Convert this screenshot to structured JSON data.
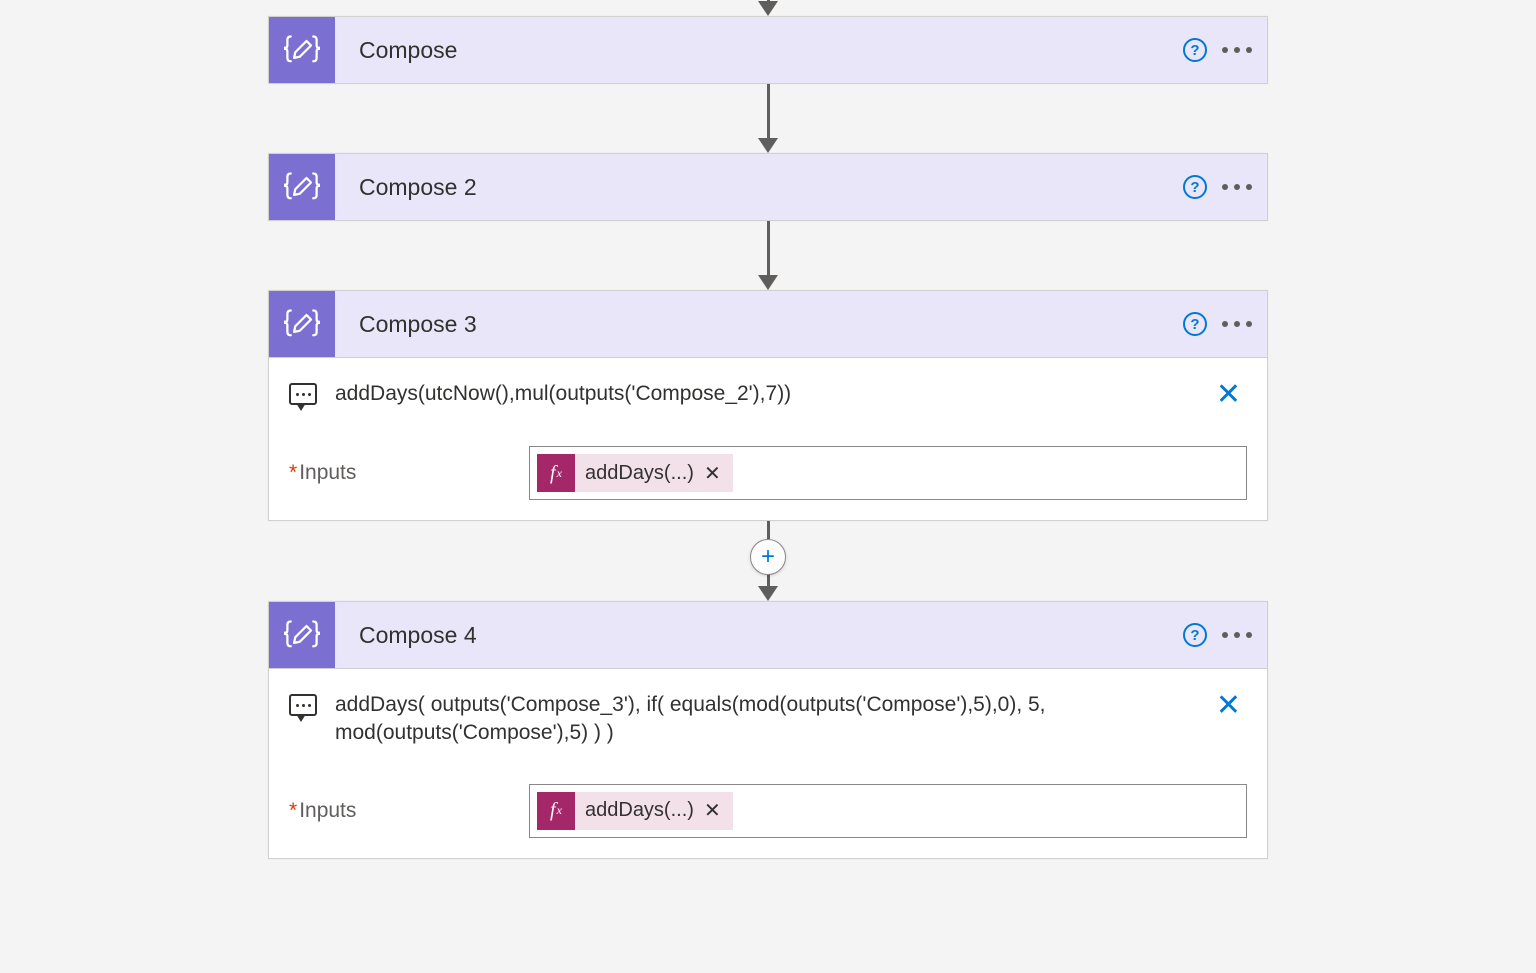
{
  "actions": [
    {
      "title": "Compose",
      "expanded": false
    },
    {
      "title": "Compose 2",
      "expanded": false
    },
    {
      "title": "Compose 3",
      "expanded": true,
      "peek": "addDays(utcNow(),mul(outputs('Compose_2'),7))",
      "inputs_label": "Inputs",
      "token": "addDays(...)"
    },
    {
      "title": "Compose 4",
      "expanded": true,
      "peek": "addDays( outputs('Compose_3'), if( equals(mod(outputs('Compose'),5),0), 5, mod(outputs('Compose'),5) ) )",
      "inputs_label": "Inputs",
      "token": "addDays(...)"
    }
  ],
  "connector_after_has_plus_index": 2,
  "top_arrow_visible": true
}
